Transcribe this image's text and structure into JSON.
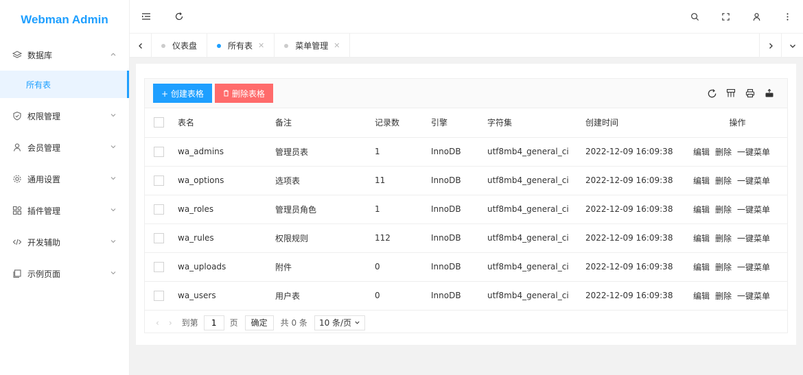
{
  "app": {
    "title": "Webman Admin"
  },
  "sidebar": {
    "items": [
      {
        "label": "数据库",
        "icon": "layers-icon",
        "expanded": true
      },
      {
        "label": "权限管理",
        "icon": "shield-icon"
      },
      {
        "label": "会员管理",
        "icon": "user-icon"
      },
      {
        "label": "通用设置",
        "icon": "gear-icon"
      },
      {
        "label": "插件管理",
        "icon": "plugin-icon"
      },
      {
        "label": "开发辅助",
        "icon": "code-icon"
      },
      {
        "label": "示例页面",
        "icon": "page-icon"
      }
    ],
    "subitem": {
      "label": "所有表",
      "active": true
    }
  },
  "tabs": [
    {
      "label": "仪表盘",
      "active": false
    },
    {
      "label": "所有表",
      "active": true
    },
    {
      "label": "菜单管理",
      "active": false
    }
  ],
  "toolbar": {
    "create_label": "+ 创建表格",
    "delete_label": "删除表格"
  },
  "table": {
    "headers": [
      "表名",
      "备注",
      "记录数",
      "引擎",
      "字符集",
      "创建时间",
      "操作"
    ],
    "rows": [
      {
        "name": "wa_admins",
        "comment": "管理员表",
        "count": "1",
        "engine": "InnoDB",
        "charset": "utf8mb4_general_ci",
        "created": "2022-12-09 16:09:38"
      },
      {
        "name": "wa_options",
        "comment": "选项表",
        "count": "11",
        "engine": "InnoDB",
        "charset": "utf8mb4_general_ci",
        "created": "2022-12-09 16:09:38"
      },
      {
        "name": "wa_roles",
        "comment": "管理员角色",
        "count": "1",
        "engine": "InnoDB",
        "charset": "utf8mb4_general_ci",
        "created": "2022-12-09 16:09:38"
      },
      {
        "name": "wa_rules",
        "comment": "权限规则",
        "count": "112",
        "engine": "InnoDB",
        "charset": "utf8mb4_general_ci",
        "created": "2022-12-09 16:09:38"
      },
      {
        "name": "wa_uploads",
        "comment": "附件",
        "count": "0",
        "engine": "InnoDB",
        "charset": "utf8mb4_general_ci",
        "created": "2022-12-09 16:09:38"
      },
      {
        "name": "wa_users",
        "comment": "用户表",
        "count": "0",
        "engine": "InnoDB",
        "charset": "utf8mb4_general_ci",
        "created": "2022-12-09 16:09:38"
      }
    ],
    "ops": {
      "edit": "编辑",
      "delete": "删除",
      "menu": "一键菜单"
    }
  },
  "pager": {
    "goto": "到第",
    "page_value": "1",
    "page_unit": "页",
    "confirm": "确定",
    "total": "共 0 条",
    "per_page": "10 条/页"
  },
  "colors": {
    "accent": "#1e9fff",
    "danger": "#ff6b6b"
  }
}
